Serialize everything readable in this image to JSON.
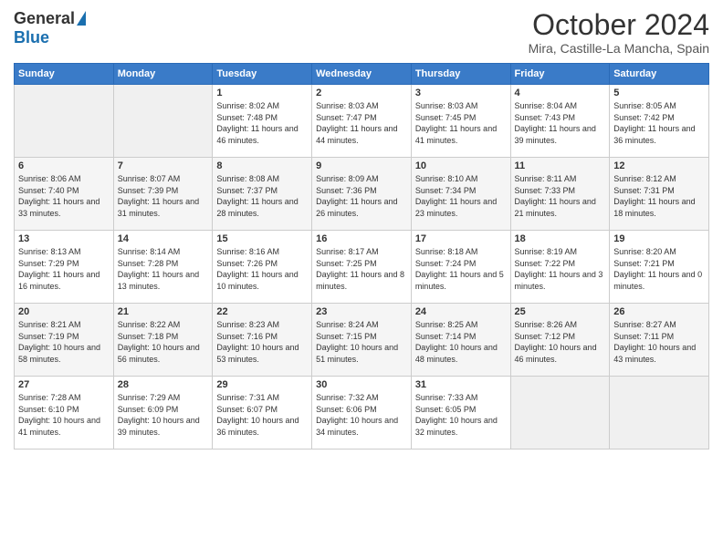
{
  "header": {
    "logo_general": "General",
    "logo_blue": "Blue",
    "title": "October 2024",
    "subtitle": "Mira, Castille-La Mancha, Spain"
  },
  "days_of_week": [
    "Sunday",
    "Monday",
    "Tuesday",
    "Wednesday",
    "Thursday",
    "Friday",
    "Saturday"
  ],
  "weeks": [
    [
      {
        "day": "",
        "sunrise": "",
        "sunset": "",
        "daylight": "",
        "empty": true
      },
      {
        "day": "",
        "sunrise": "",
        "sunset": "",
        "daylight": "",
        "empty": true
      },
      {
        "day": "1",
        "sunrise": "Sunrise: 8:02 AM",
        "sunset": "Sunset: 7:48 PM",
        "daylight": "Daylight: 11 hours and 46 minutes."
      },
      {
        "day": "2",
        "sunrise": "Sunrise: 8:03 AM",
        "sunset": "Sunset: 7:47 PM",
        "daylight": "Daylight: 11 hours and 44 minutes."
      },
      {
        "day": "3",
        "sunrise": "Sunrise: 8:03 AM",
        "sunset": "Sunset: 7:45 PM",
        "daylight": "Daylight: 11 hours and 41 minutes."
      },
      {
        "day": "4",
        "sunrise": "Sunrise: 8:04 AM",
        "sunset": "Sunset: 7:43 PM",
        "daylight": "Daylight: 11 hours and 39 minutes."
      },
      {
        "day": "5",
        "sunrise": "Sunrise: 8:05 AM",
        "sunset": "Sunset: 7:42 PM",
        "daylight": "Daylight: 11 hours and 36 minutes."
      }
    ],
    [
      {
        "day": "6",
        "sunrise": "Sunrise: 8:06 AM",
        "sunset": "Sunset: 7:40 PM",
        "daylight": "Daylight: 11 hours and 33 minutes."
      },
      {
        "day": "7",
        "sunrise": "Sunrise: 8:07 AM",
        "sunset": "Sunset: 7:39 PM",
        "daylight": "Daylight: 11 hours and 31 minutes."
      },
      {
        "day": "8",
        "sunrise": "Sunrise: 8:08 AM",
        "sunset": "Sunset: 7:37 PM",
        "daylight": "Daylight: 11 hours and 28 minutes."
      },
      {
        "day": "9",
        "sunrise": "Sunrise: 8:09 AM",
        "sunset": "Sunset: 7:36 PM",
        "daylight": "Daylight: 11 hours and 26 minutes."
      },
      {
        "day": "10",
        "sunrise": "Sunrise: 8:10 AM",
        "sunset": "Sunset: 7:34 PM",
        "daylight": "Daylight: 11 hours and 23 minutes."
      },
      {
        "day": "11",
        "sunrise": "Sunrise: 8:11 AM",
        "sunset": "Sunset: 7:33 PM",
        "daylight": "Daylight: 11 hours and 21 minutes."
      },
      {
        "day": "12",
        "sunrise": "Sunrise: 8:12 AM",
        "sunset": "Sunset: 7:31 PM",
        "daylight": "Daylight: 11 hours and 18 minutes."
      }
    ],
    [
      {
        "day": "13",
        "sunrise": "Sunrise: 8:13 AM",
        "sunset": "Sunset: 7:29 PM",
        "daylight": "Daylight: 11 hours and 16 minutes."
      },
      {
        "day": "14",
        "sunrise": "Sunrise: 8:14 AM",
        "sunset": "Sunset: 7:28 PM",
        "daylight": "Daylight: 11 hours and 13 minutes."
      },
      {
        "day": "15",
        "sunrise": "Sunrise: 8:16 AM",
        "sunset": "Sunset: 7:26 PM",
        "daylight": "Daylight: 11 hours and 10 minutes."
      },
      {
        "day": "16",
        "sunrise": "Sunrise: 8:17 AM",
        "sunset": "Sunset: 7:25 PM",
        "daylight": "Daylight: 11 hours and 8 minutes."
      },
      {
        "day": "17",
        "sunrise": "Sunrise: 8:18 AM",
        "sunset": "Sunset: 7:24 PM",
        "daylight": "Daylight: 11 hours and 5 minutes."
      },
      {
        "day": "18",
        "sunrise": "Sunrise: 8:19 AM",
        "sunset": "Sunset: 7:22 PM",
        "daylight": "Daylight: 11 hours and 3 minutes."
      },
      {
        "day": "19",
        "sunrise": "Sunrise: 8:20 AM",
        "sunset": "Sunset: 7:21 PM",
        "daylight": "Daylight: 11 hours and 0 minutes."
      }
    ],
    [
      {
        "day": "20",
        "sunrise": "Sunrise: 8:21 AM",
        "sunset": "Sunset: 7:19 PM",
        "daylight": "Daylight: 10 hours and 58 minutes."
      },
      {
        "day": "21",
        "sunrise": "Sunrise: 8:22 AM",
        "sunset": "Sunset: 7:18 PM",
        "daylight": "Daylight: 10 hours and 56 minutes."
      },
      {
        "day": "22",
        "sunrise": "Sunrise: 8:23 AM",
        "sunset": "Sunset: 7:16 PM",
        "daylight": "Daylight: 10 hours and 53 minutes."
      },
      {
        "day": "23",
        "sunrise": "Sunrise: 8:24 AM",
        "sunset": "Sunset: 7:15 PM",
        "daylight": "Daylight: 10 hours and 51 minutes."
      },
      {
        "day": "24",
        "sunrise": "Sunrise: 8:25 AM",
        "sunset": "Sunset: 7:14 PM",
        "daylight": "Daylight: 10 hours and 48 minutes."
      },
      {
        "day": "25",
        "sunrise": "Sunrise: 8:26 AM",
        "sunset": "Sunset: 7:12 PM",
        "daylight": "Daylight: 10 hours and 46 minutes."
      },
      {
        "day": "26",
        "sunrise": "Sunrise: 8:27 AM",
        "sunset": "Sunset: 7:11 PM",
        "daylight": "Daylight: 10 hours and 43 minutes."
      }
    ],
    [
      {
        "day": "27",
        "sunrise": "Sunrise: 7:28 AM",
        "sunset": "Sunset: 6:10 PM",
        "daylight": "Daylight: 10 hours and 41 minutes."
      },
      {
        "day": "28",
        "sunrise": "Sunrise: 7:29 AM",
        "sunset": "Sunset: 6:09 PM",
        "daylight": "Daylight: 10 hours and 39 minutes."
      },
      {
        "day": "29",
        "sunrise": "Sunrise: 7:31 AM",
        "sunset": "Sunset: 6:07 PM",
        "daylight": "Daylight: 10 hours and 36 minutes."
      },
      {
        "day": "30",
        "sunrise": "Sunrise: 7:32 AM",
        "sunset": "Sunset: 6:06 PM",
        "daylight": "Daylight: 10 hours and 34 minutes."
      },
      {
        "day": "31",
        "sunrise": "Sunrise: 7:33 AM",
        "sunset": "Sunset: 6:05 PM",
        "daylight": "Daylight: 10 hours and 32 minutes."
      },
      {
        "day": "",
        "sunrise": "",
        "sunset": "",
        "daylight": "",
        "empty": true
      },
      {
        "day": "",
        "sunrise": "",
        "sunset": "",
        "daylight": "",
        "empty": true
      }
    ]
  ]
}
